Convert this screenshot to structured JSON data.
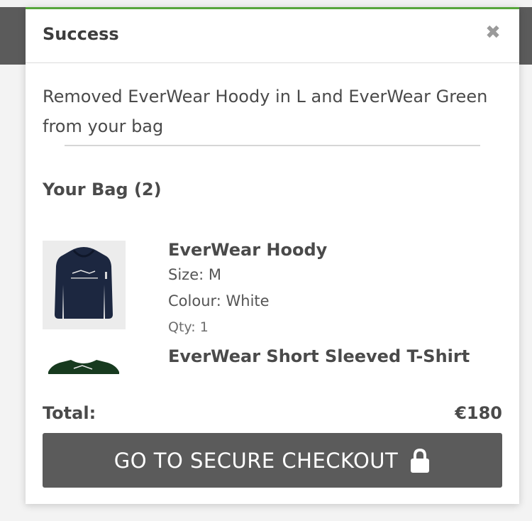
{
  "modal": {
    "title": "Success",
    "close_glyph": "✖",
    "message": "Removed EverWear Hoody in L and EverWear Green from your bag"
  },
  "bag": {
    "heading": "Your Bag (2)",
    "items": [
      {
        "name": "EverWear Hoody",
        "size": "Size: M",
        "colour": "Colour: White",
        "qty": "Qty: 1",
        "image_icon": "navy-hoodie-image",
        "image_color": "#1c2740"
      },
      {
        "name": "EverWear Short Sleeved T-Shirt",
        "image_icon": "green-tshirt-image",
        "image_color": "#173a1f"
      }
    ]
  },
  "total": {
    "label": "Total:",
    "value": "€180"
  },
  "checkout": {
    "label": "GO TO SECURE CHECKOUT",
    "icon": "lock-icon"
  },
  "colors": {
    "accent": "#57a63c",
    "button_bg": "#5b5b5b"
  }
}
